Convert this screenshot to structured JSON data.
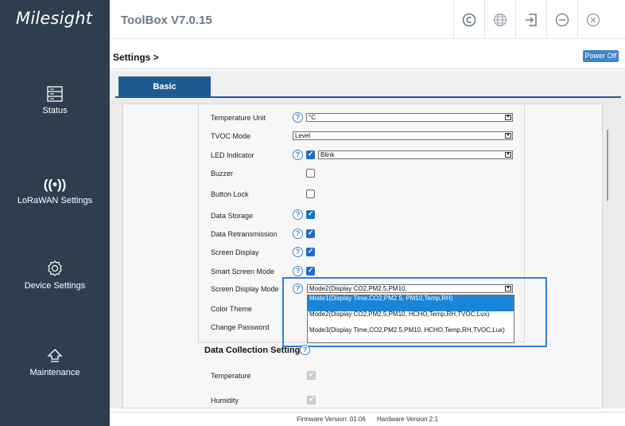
{
  "brand": "Milesight",
  "app_title": "ToolBox V7.0.15",
  "sidebar": [
    {
      "label": "Status",
      "icon": "status-icon"
    },
    {
      "label": "LoRaWAN Settings",
      "icon": "wireless-icon"
    },
    {
      "label": "Device Settings",
      "icon": "gear-icon"
    },
    {
      "label": "Maintenance",
      "icon": "maintenance-icon"
    }
  ],
  "header_icons": [
    "copyright-icon",
    "globe-icon",
    "logout-icon",
    "minimize-icon",
    "close-icon"
  ],
  "breadcrumb": "Settings >",
  "power_button": "Power Off",
  "tabs": [
    {
      "label": "Basic",
      "active": true
    }
  ],
  "settings": {
    "temperature_unit": {
      "label": "Temperature Unit",
      "value": "°C"
    },
    "tvoc_mode": {
      "label": "TVOC Mode",
      "value": "Level"
    },
    "led_indicator": {
      "label": "LED Indicator",
      "value": "Blink",
      "checked": true
    },
    "buzzer": {
      "label": "Buzzer",
      "checked": false
    },
    "button_lock": {
      "label": "Button Lock",
      "checked": false
    },
    "data_storage": {
      "label": "Data Storage",
      "checked": true
    },
    "data_retransmission": {
      "label": "Data Retransmission",
      "checked": true
    },
    "screen_display": {
      "label": "Screen Display",
      "checked": true
    },
    "smart_screen_mode": {
      "label": "Smart Screen Mode",
      "checked": true
    },
    "screen_display_mode": {
      "label": "Screen Display Mode",
      "value": "Mode2(Display CO2,PM2.5,PM10,",
      "options": [
        "Mode1(Display Time,CO2,PM2.5, PM10,Temp,RH)",
        "Mode2(Display CO2,PM2.5,PM10, HCHO,Temp,RH,TVOC,Lux)",
        "Mode3(Display Time,CO2,PM2.5,PM10, HCHO,Temp,RH,TVOC,Lux)"
      ],
      "selected_index": 0
    },
    "color_theme": {
      "label": "Color Theme"
    },
    "change_password": {
      "label": "Change Password"
    }
  },
  "data_collection": {
    "title": "Data Collection Settings",
    "items": [
      {
        "label": "Temperature",
        "checked": true,
        "disabled": true
      },
      {
        "label": "Humidity",
        "checked": true,
        "disabled": true
      }
    ]
  },
  "footer": {
    "firmware": "Firmware Version:  01.06",
    "hardware": "Hardware Version  2.1"
  },
  "colors": {
    "sidebar": "#2f3e4e",
    "accent": "#1e5b93",
    "highlight": "#1a84d8"
  }
}
